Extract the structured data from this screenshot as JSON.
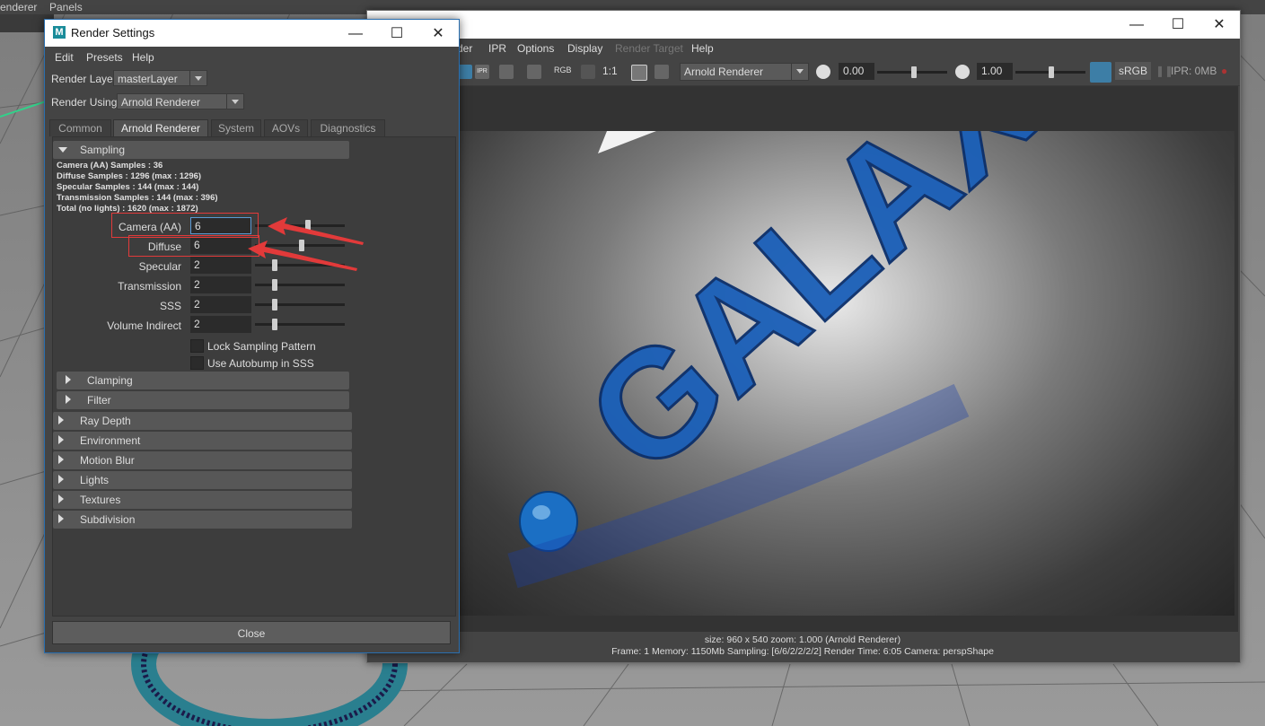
{
  "host": {
    "menu_renderer": "enderer",
    "menu_panels": "Panels"
  },
  "render_view": {
    "menus": [
      "der",
      "IPR",
      "Options",
      "Display",
      "Render Target",
      "Help"
    ],
    "toolbar": {
      "ipr_label": "IPR",
      "rgb_label": "RGB",
      "ratio_label": "1:1",
      "renderer": "Arnold Renderer",
      "exposure": "0.00",
      "gamma": "1.00",
      "colorspace": "sRGB",
      "ipr_memory": "IPR: 0MB"
    },
    "status_line1": "size: 960 x 540 zoom: 1.000    (Arnold Renderer)",
    "status_line2": "Frame: 1    Memory: 1150Mb    Sampling: [6/6/2/2/2/2]    Render Time: 6:05    Camera: perspShape",
    "image_text": "GALAXY"
  },
  "render_settings": {
    "title": "Render Settings",
    "menus": [
      "Edit",
      "Presets",
      "Help"
    ],
    "render_layer_label": "Render Layer",
    "render_layer_value": "masterLayer",
    "render_using_label": "Render Using",
    "render_using_value": "Arnold Renderer",
    "tabs": [
      "Common",
      "Arnold Renderer",
      "System",
      "AOVs",
      "Diagnostics"
    ],
    "sampling_title": "Sampling",
    "info": [
      "Camera (AA) Samples : 36",
      "Diffuse Samples : 1296 (max : 1296)",
      "Specular Samples : 144 (max : 144)",
      "Transmission Samples : 144 (max : 396)",
      "Total (no lights) : 1620 (max : 1872)"
    ],
    "fields": [
      {
        "label": "Camera (AA)",
        "value": "6",
        "level": 0.6
      },
      {
        "label": "Diffuse",
        "value": "6",
        "level": 0.52
      },
      {
        "label": "Specular",
        "value": "2",
        "level": 0.2
      },
      {
        "label": "Transmission",
        "value": "2",
        "level": 0.2
      },
      {
        "label": "SSS",
        "value": "2",
        "level": 0.2
      },
      {
        "label": "Volume Indirect",
        "value": "2",
        "level": 0.2
      }
    ],
    "checkboxes": [
      "Lock Sampling Pattern",
      "Use Autobump in SSS"
    ],
    "subsections": [
      "Clamping",
      "Filter"
    ],
    "sections": [
      "Ray Depth",
      "Environment",
      "Motion Blur",
      "Lights",
      "Textures",
      "Subdivision"
    ],
    "close_label": "Close"
  },
  "colors": {
    "annotation": "#e23a3a",
    "accent_blue": "#2a6fb0",
    "ipr_on": "#3d7ea6"
  }
}
